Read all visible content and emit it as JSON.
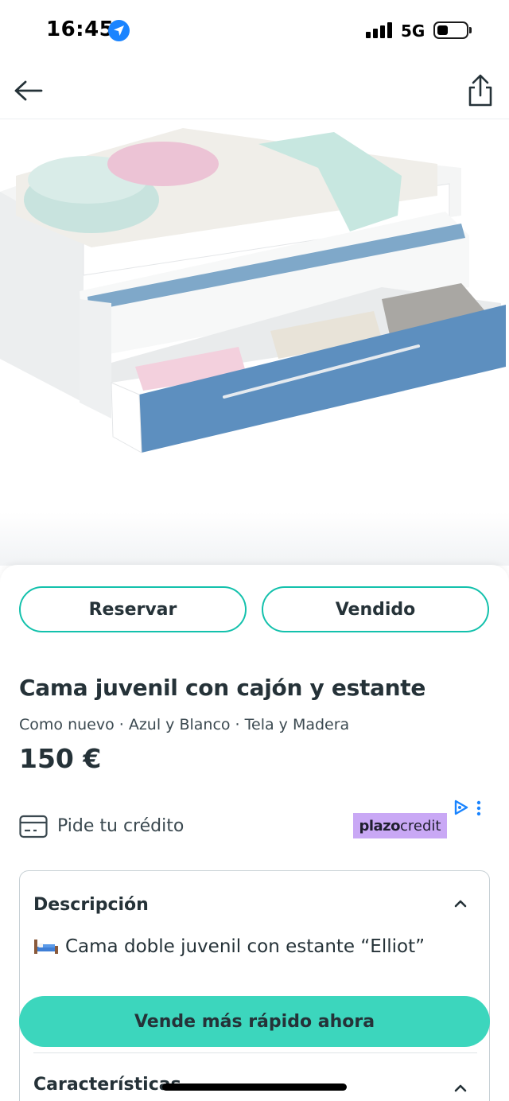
{
  "status_bar": {
    "time": "16:45",
    "network": "5G",
    "battery_level": 0.25
  },
  "nav": {
    "back_icon": "arrow-left-icon",
    "share_icon": "share-icon"
  },
  "actions": {
    "reserve_label": "Reservar",
    "sold_label": "Vendido"
  },
  "product": {
    "title": "Cama juvenil con cajón y estante",
    "attributes": "Como nuevo · Azul y Blanco · Tela y Madera",
    "price": "150 €"
  },
  "credit": {
    "label": "Pide tu crédito",
    "brand_bold": "plazo",
    "brand_light": "credit"
  },
  "description": {
    "heading": "Descripción",
    "text": "Cama doble juvenil con estante “Elliot”",
    "features_heading": "Características"
  },
  "cta": {
    "sell_faster_label": "Vende más rápido ahora"
  },
  "colors": {
    "accent": "#13c1ac",
    "cta": "#3cd6bd",
    "text": "#253238",
    "credit_badge": "#c9a8f5"
  }
}
